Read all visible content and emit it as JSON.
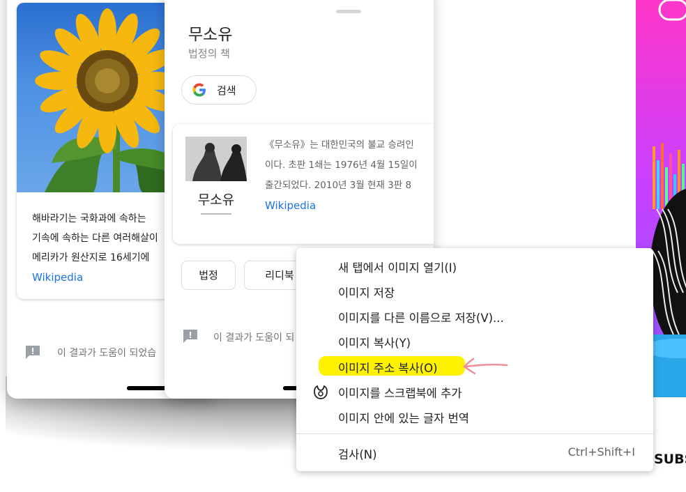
{
  "sunflower_card": {
    "lines": [
      "해바라기는 국화과에 속하는 ",
      "기속에 속하는 다른 여러해살이",
      "메리카가 원산지로 16세기에 "
    ],
    "source": "Wikipedia"
  },
  "feedback_text_1": "이 결과가 도움이 되었습",
  "book_panel": {
    "title": "무소유",
    "subtitle": "법정의 책",
    "search_chip": "검색",
    "description_lines": [
      "《무소유》는 대한민국의 불교 승려인 ",
      "이다. 초판 1쇄는 1976년 4월 15일이",
      "출간되었다. 2010년 3월 현재 3판 8"
    ],
    "source": "Wikipedia",
    "cover_title": "무소유",
    "chips": [
      "법정",
      "리디북"
    ],
    "feedback_text": "이 결과가 도움이 되"
  },
  "side_text": "SUBS",
  "context_menu": {
    "items": [
      {
        "label": "새 탭에서 이미지 열기(I)"
      },
      {
        "label": "이미지 저장"
      },
      {
        "label": "이미지를 다른 이름으로 저장(V)..."
      },
      {
        "label": "이미지 복사(Y)"
      },
      {
        "label": "이미지 주소 복사(O)",
        "highlighted": true
      },
      {
        "label": "이미지를 스크랩북에 추가",
        "icon": "scrapbook-icon"
      },
      {
        "label": "이미지 안에 있는 글자 번역"
      }
    ],
    "inspect": {
      "label": "검사(N)",
      "shortcut": "Ctrl+Shift+I"
    }
  },
  "colors": {
    "highlight": "#fff200",
    "annotation_arrow": "#f08c98",
    "link_blue": "#1a73e8"
  }
}
